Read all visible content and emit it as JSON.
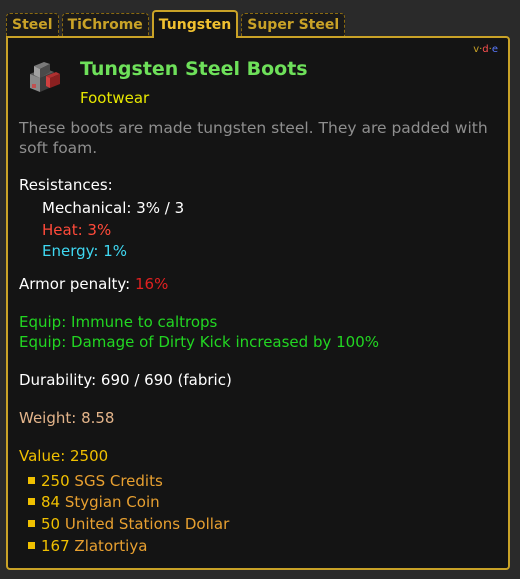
{
  "tabs": [
    "Steel",
    "TiChrome",
    "Tungsten",
    "Super Steel"
  ],
  "active_tab": "Tungsten",
  "navbox": {
    "v": "v",
    "sep1": "·",
    "d": "d",
    "sep2": "·",
    "e": "e"
  },
  "item": {
    "name": "Tungsten Steel Boots",
    "slot": "Footwear",
    "description": "These boots are made tungsten steel. They are padded with soft foam.",
    "icon": "boots-icon"
  },
  "resistances": {
    "heading": "Resistances:",
    "mechanical": "Mechanical: 3% / 3",
    "heat": "Heat: 3%",
    "energy": "Energy: 1%"
  },
  "armor_penalty": {
    "label": "Armor penalty:",
    "value": "16%"
  },
  "equip": [
    {
      "label": "Equip:",
      "text": "Immune to caltrops"
    },
    {
      "label": "Equip:",
      "text": "Damage of Dirty Kick increased by 100%"
    }
  ],
  "durability": "Durability: 690 / 690 (fabric)",
  "weight": "Weight: 8.58",
  "value": {
    "label": "Value: 2500",
    "currencies": [
      {
        "amount": "250",
        "name": "SGS Credits"
      },
      {
        "amount": "84",
        "name": "Stygian Coin"
      },
      {
        "amount": "50",
        "name": "United Stations Dollar"
      },
      {
        "amount": "167",
        "name": "Zlatortiya"
      }
    ]
  },
  "colors": {
    "gold": "#c9a227",
    "title_green": "#6ee05a",
    "equip_green": "#22d622",
    "heat_red": "#ff4a3a",
    "energy_cyan": "#3fd8f2",
    "penalty_red": "#e02020",
    "weight": "#e3b48a",
    "value_yellow": "#f0c000",
    "currency_name": "#e8a030"
  }
}
